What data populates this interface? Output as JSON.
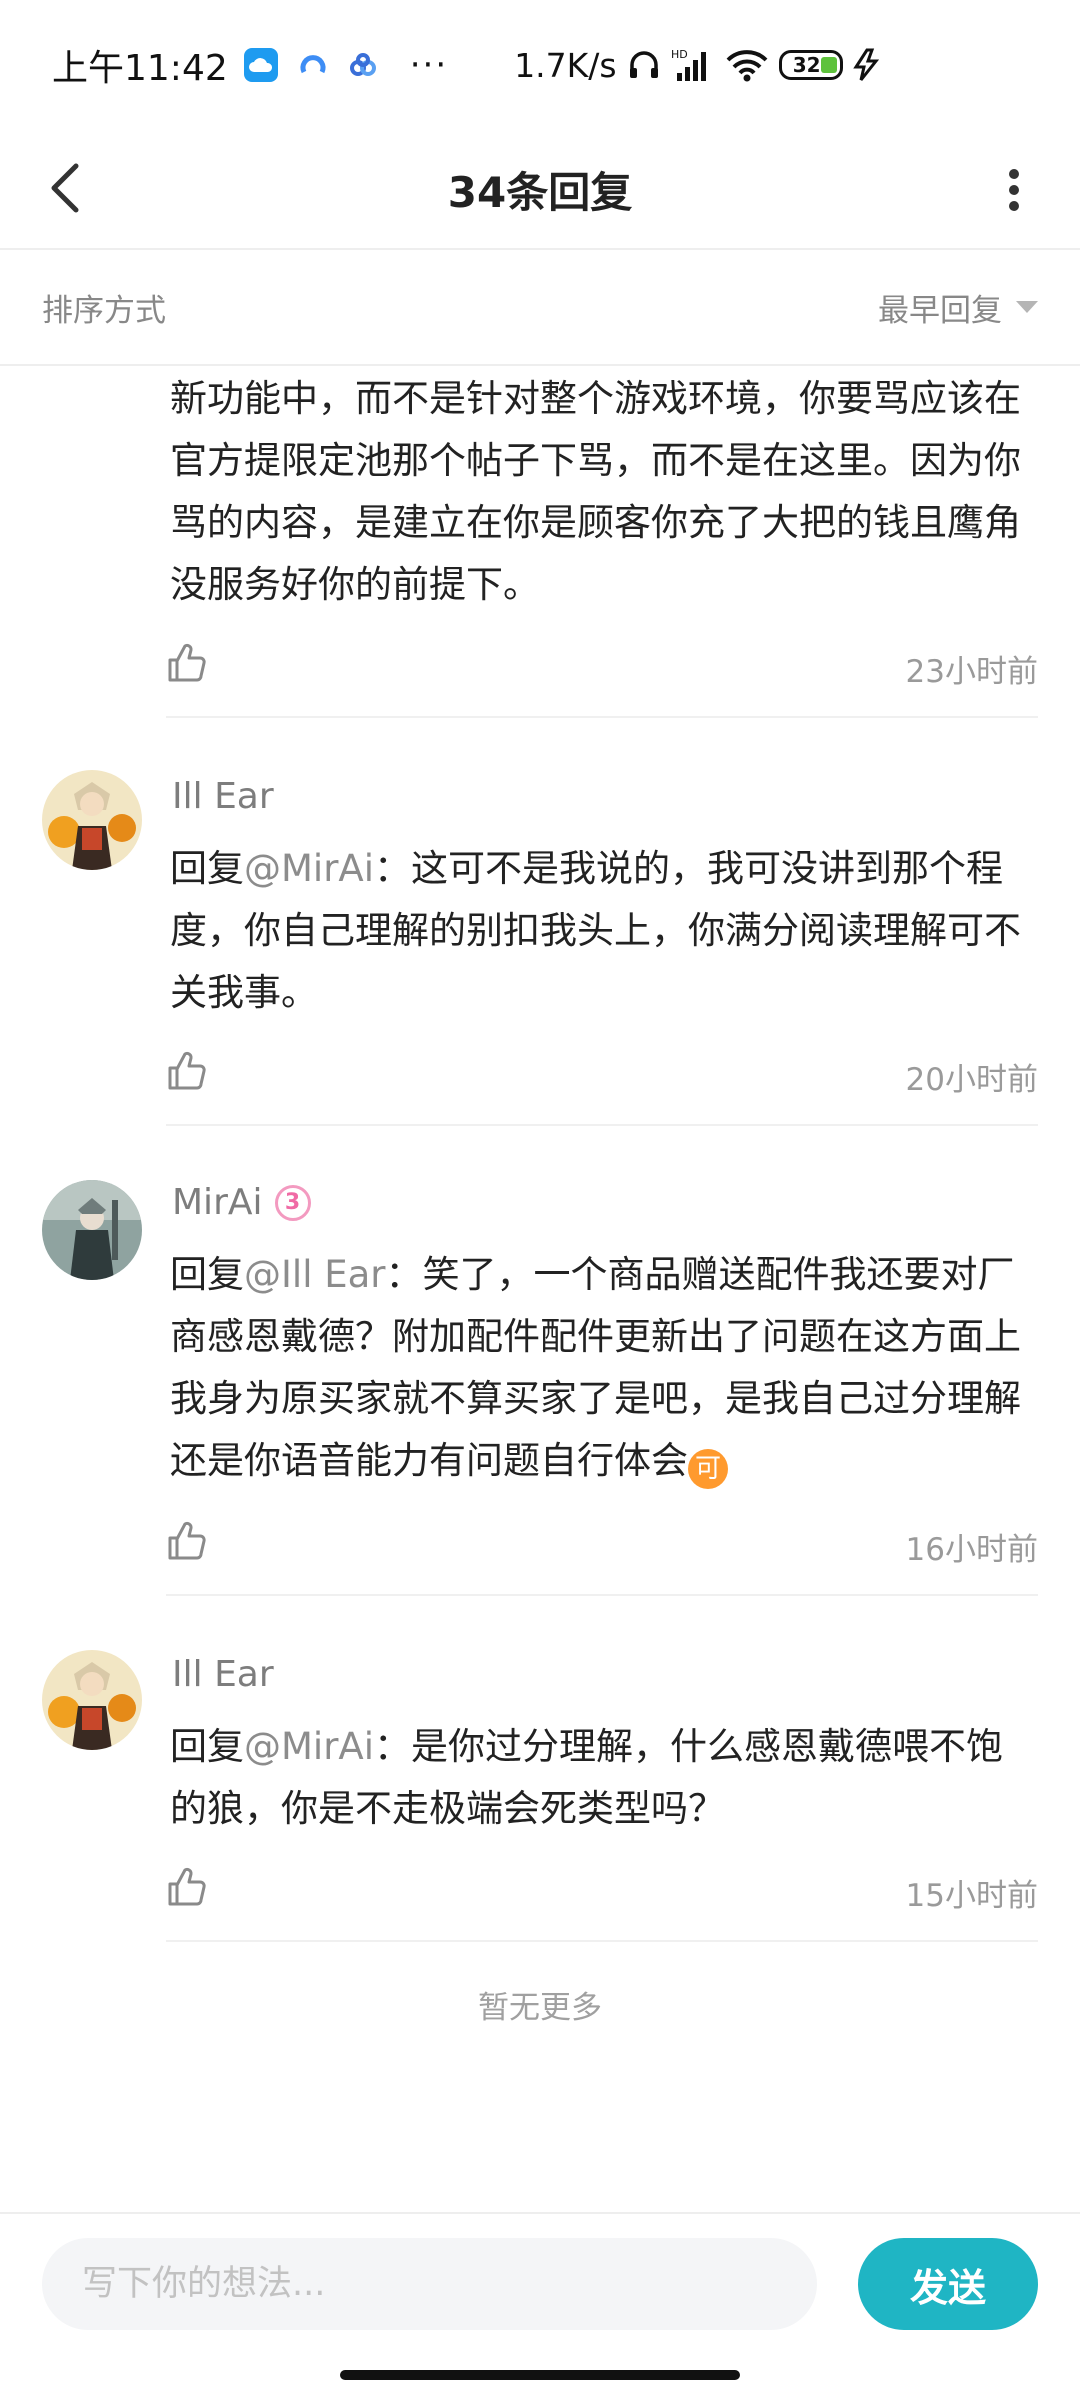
{
  "status_bar": {
    "time": "上午11:42",
    "overflow": "···",
    "speed": "1.7K/s",
    "signal_label": "HD",
    "battery": "32"
  },
  "header": {
    "title": "34条回复"
  },
  "sort_bar": {
    "label": "排序方式",
    "selected": "最早回复"
  },
  "comments": [
    {
      "user": "",
      "text": "新功能中，而不是针对整个游戏环境，你要骂应该在官方提限定池那个帖子下骂，而不是在这里。因为你骂的内容，是建立在你是顾客你充了大把的钱且鹰角没服务好你的前提下。",
      "time": "23小时前"
    },
    {
      "user": "Ill Ear",
      "reply_prefix": "回复",
      "mention": "@MirAi",
      "text": "：这可不是我说的，我可没讲到那个程度，你自己理解的别扣我头上，你满分阅读理解可不关我事。",
      "time": "20小时前"
    },
    {
      "user": "MirAi",
      "user_badge": "3",
      "reply_prefix": "回复",
      "mention": "@Ill Ear",
      "text": "：笑了，一个商品赠送配件我还要对厂商感恩戴德？附加配件配件更新出了问题在这方面上我身为原买家就不算买家了是吧，是我自己过分理解还是你语音能力有问题自行体会",
      "emoji": "可",
      "time": "16小时前"
    },
    {
      "user": "Ill Ear",
      "reply_prefix": "回复",
      "mention": "@MirAi",
      "text": "：是你过分理解，什么感恩戴德喂不饱的狼，你是不走极端会死类型吗？",
      "time": "15小时前"
    }
  ],
  "footer_note": "暂无更多",
  "input": {
    "placeholder": "写下你的想法...",
    "send_label": "发送"
  },
  "colors": {
    "accent": "#1fb5c4",
    "muted": "#9a9a9a"
  },
  "icons": [
    "back-icon",
    "more-vertical-icon",
    "thumbs-up-icon",
    "caret-down-icon",
    "wifi-icon",
    "signal-icon",
    "headset-icon",
    "charging-icon"
  ]
}
